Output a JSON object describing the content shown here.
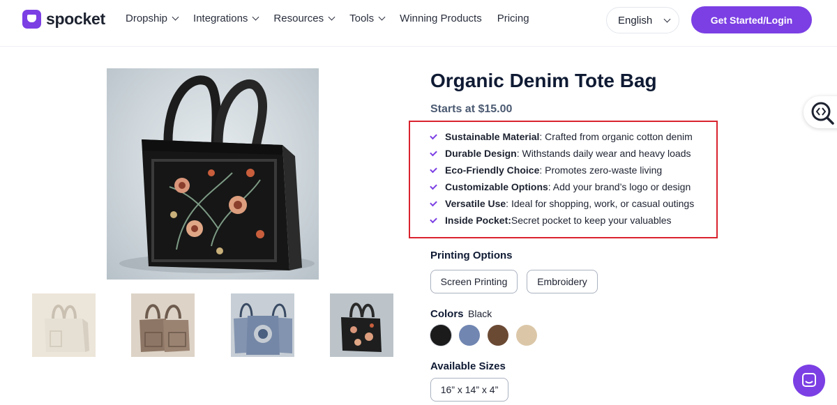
{
  "brand": {
    "name": "spocket",
    "accent": "#7b3fe4"
  },
  "nav": [
    {
      "label": "Dropship",
      "has_dropdown": true
    },
    {
      "label": "Integrations",
      "has_dropdown": true
    },
    {
      "label": "Resources",
      "has_dropdown": true
    },
    {
      "label": "Tools",
      "has_dropdown": true
    },
    {
      "label": "Winning Products",
      "has_dropdown": false
    },
    {
      "label": "Pricing",
      "has_dropdown": false
    }
  ],
  "language": {
    "selected": "English"
  },
  "cta": {
    "label": "Get Started/Login"
  },
  "product": {
    "title": "Organic Denim Tote Bag",
    "price": "Starts at $15.00",
    "features": [
      {
        "name": "Sustainable Material",
        "desc": ": Crafted from organic cotton denim"
      },
      {
        "name": "Durable Design",
        "desc": ": Withstands daily wear and heavy loads"
      },
      {
        "name": "Eco-Friendly Choice",
        "desc": ": Promotes zero-waste living"
      },
      {
        "name": "Customizable Options",
        "desc": ": Add your brand’s logo or design"
      },
      {
        "name": "Versatile Use",
        "desc": ": Ideal for shopping, work, or casual outings"
      },
      {
        "name": "Inside Pocket:",
        "desc": " Secret pocket to keep your valuables"
      }
    ],
    "printing": {
      "label": "Printing Options",
      "options": [
        "Screen Printing",
        "Embroidery"
      ]
    },
    "colors": {
      "label": "Colors",
      "selected": "Black",
      "swatches": [
        "#1b1b1b",
        "#7186b1",
        "#6b4a34",
        "#dbc7a8"
      ]
    },
    "sizes": {
      "label": "Available Sizes",
      "options": [
        "16” x 14” x 4”"
      ]
    }
  },
  "icons": {
    "search_tab": "search-code-icon",
    "chat": "chat-icon",
    "check": "check-icon"
  }
}
